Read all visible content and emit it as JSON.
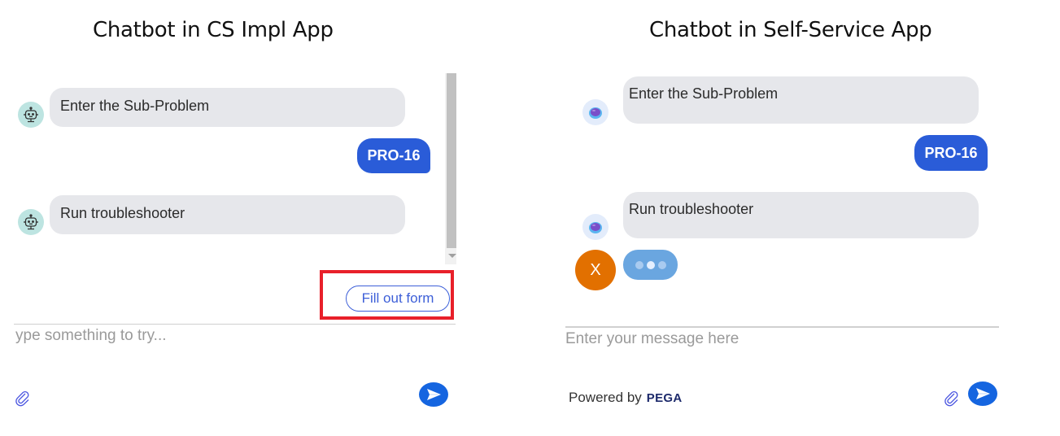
{
  "left_panel": {
    "title": "Chatbot in CS Impl App",
    "messages": [
      {
        "sender": "bot",
        "text": "Enter the Sub-Problem",
        "avatar_icon": "robot-icon"
      },
      {
        "sender": "user",
        "text": "PRO-16"
      },
      {
        "sender": "bot",
        "text": "Run troubleshooter",
        "avatar_icon": "robot-icon"
      }
    ],
    "action_button": "Fill out form",
    "input_placeholder": "Type something to try...",
    "input_visible_text": "ype something to try...",
    "attach_icon": "paperclip-icon",
    "send_icon": "send-icon",
    "highlight_color": "#e8202a"
  },
  "right_panel": {
    "title": "Chatbot in Self-Service App",
    "messages": [
      {
        "sender": "bot",
        "text": "Enter the Sub-Problem",
        "avatar_icon": "astronaut-helmet-icon"
      },
      {
        "sender": "user",
        "text": "PRO-16"
      },
      {
        "sender": "bot",
        "text": "Run troubleshooter",
        "avatar_icon": "astronaut-helmet-icon"
      }
    ],
    "user_avatar_initial": "X",
    "typing_indicator": "typing-dots",
    "input_placeholder": "Enter your message here",
    "powered_by_label": "Powered by",
    "powered_by_brand": "PEGA",
    "attach_icon": "paperclip-icon",
    "send_icon": "send-icon"
  },
  "colors": {
    "user_bubble": "#2a5cd8",
    "bot_bubble": "#e6e7eb",
    "send_button": "#1565e0",
    "user_avatar": "#e27000",
    "typing_bubble": "#6aa6e0"
  }
}
